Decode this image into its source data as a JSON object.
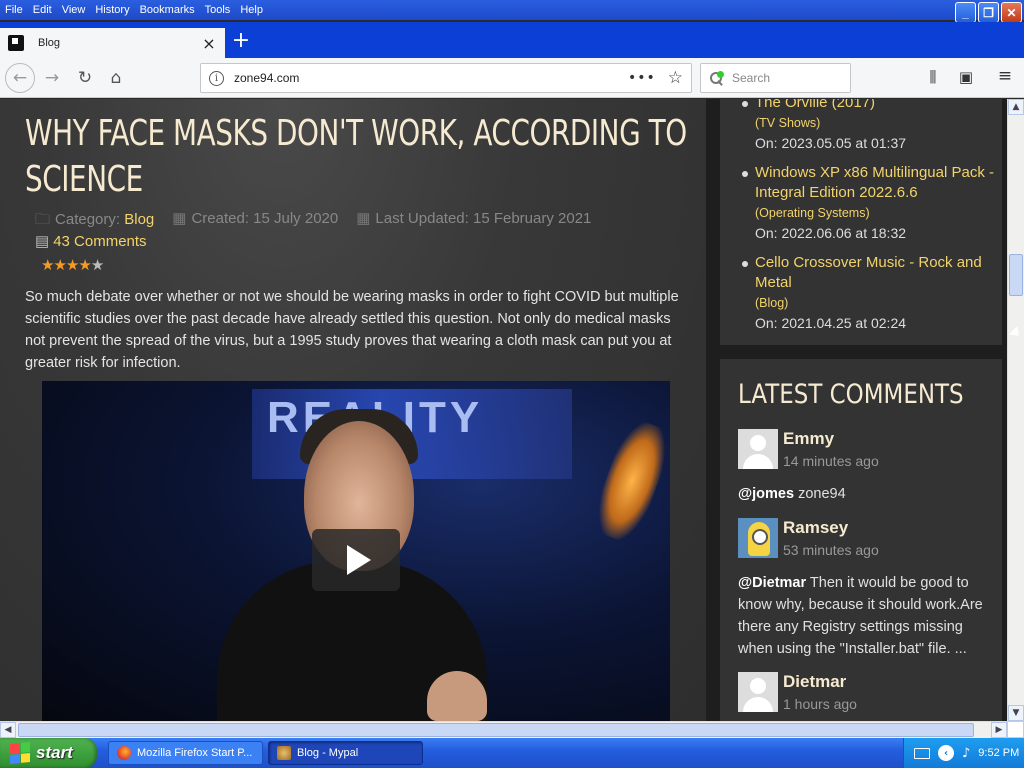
{
  "menubar": {
    "items": [
      "File",
      "Edit",
      "View",
      "History",
      "Bookmarks",
      "Tools",
      "Help"
    ]
  },
  "window_controls": {
    "minimize": "_",
    "restore": "❐",
    "close": "✕"
  },
  "tab": {
    "title": "Blog",
    "close": "×",
    "new_tab": "+"
  },
  "navbar": {
    "url": "zone94.com",
    "more": "•••",
    "search_placeholder": "Search"
  },
  "article": {
    "title": "WHY FACE MASKS DON'T WORK, ACCORDING TO SCIENCE",
    "category_label": "Category:",
    "category": "Blog",
    "created": "Created: 15 July 2020",
    "updated": "Last Updated: 15 February 2021",
    "comments": "43 Comments",
    "rating_stars": 3.5,
    "intro": "So much debate over whether or not we should be wearing masks in order to fight COVID but multiple scientific studies over the past decade have already settled this question. Not only do medical masks not prevent the spread of the virus, but a 1995 study proves that wearing a cloth mask can put you at greater risk for infection.",
    "video_banner_text": "REALITY"
  },
  "sidebar": {
    "recent_items": [
      {
        "title": "The Orville (2017)",
        "category": "(TV Shows)",
        "date": "On: 2023.05.05 at 01:37"
      },
      {
        "title": "Windows XP x86 Multilingual Pack - Integral Edition 2022.6.6",
        "category": "(Operating Systems)",
        "date": "On: 2022.06.06 at 18:32"
      },
      {
        "title": "Cello Crossover Music - Rock and Metal",
        "category": "(Blog)",
        "date": "On: 2021.04.25 at 02:24"
      }
    ],
    "latest_comments_title": "LATEST COMMENTS",
    "comments": [
      {
        "name": "Emmy",
        "time": "14 minutes ago",
        "mention": "@jomes",
        "text": " zone94"
      },
      {
        "name": "Ramsey",
        "time": "53 minutes ago",
        "mention": "@Dietmar",
        "text": " Then it would be good to know why, because it should work.Are there any Registry settings missing when using the \"Installer.bat\" file. ..."
      },
      {
        "name": "Dietmar",
        "time": "1 hours ago",
        "mention": "",
        "text": ""
      }
    ],
    "to_top": "↑"
  },
  "taskbar": {
    "start": "start",
    "tasks": [
      "Mozilla Firefox Start P...",
      "Blog - Mypal"
    ],
    "clock": "9:52 PM"
  }
}
